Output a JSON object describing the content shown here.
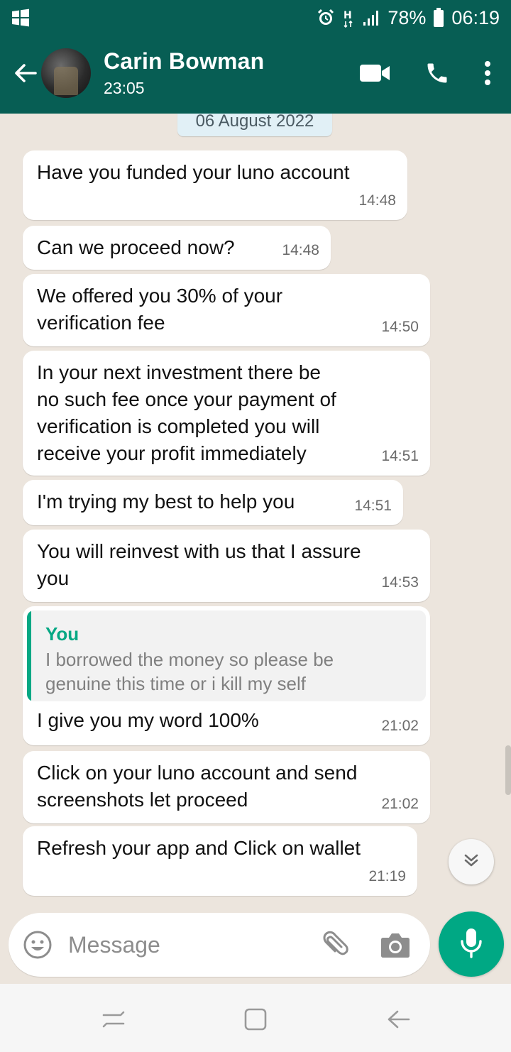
{
  "status_bar": {
    "battery": "78%",
    "time": "06:19",
    "icons": [
      "windows-icon",
      "alarm-icon",
      "h-plus-icon",
      "signal-icon",
      "battery-icon"
    ]
  },
  "header": {
    "contact_name": "Carin Bowman",
    "last_seen": "23:05",
    "icons": [
      "back-arrow-icon",
      "video-call-icon",
      "phone-icon",
      "more-vert-icon"
    ]
  },
  "chat": {
    "date_label": "06 August 2022",
    "messages": [
      {
        "lines": [
          "Have you funded your luno account"
        ],
        "time": "14:48"
      },
      {
        "lines": [
          "Can we proceed now?"
        ],
        "time": "14:48"
      },
      {
        "lines": [
          "We offered you 30% of your",
          "verification fee"
        ],
        "time": "14:50"
      },
      {
        "lines": [
          "In your next investment there be",
          "no such fee once your payment of",
          "verification is completed you will",
          "receive your profit immediately"
        ],
        "time": "14:51"
      },
      {
        "lines": [
          "I'm trying my best to help you"
        ],
        "time": "14:51"
      },
      {
        "lines": [
          "You will reinvest with us that I assure",
          "you"
        ],
        "time": "14:53"
      },
      {
        "quote": {
          "author": "You",
          "lines": [
            "I borrowed the money so please be",
            "genuine this time or i kill my self"
          ]
        },
        "lines": [
          "I give you my word 100%"
        ],
        "time": "21:02"
      },
      {
        "lines": [
          "Click on your luno account and send",
          "screenshots let proceed"
        ],
        "time": "21:02"
      },
      {
        "lines": [
          "Refresh your app and Click on wallet"
        ],
        "time": "21:19"
      }
    ]
  },
  "composer": {
    "placeholder": "Message",
    "icons": [
      "emoji-icon",
      "attach-icon",
      "camera-icon",
      "mic-icon"
    ]
  },
  "colors": {
    "header_bg": "#075e54",
    "chat_bg": "#ece5dd",
    "accent": "#00a884",
    "quote_accent": "#06a884"
  }
}
